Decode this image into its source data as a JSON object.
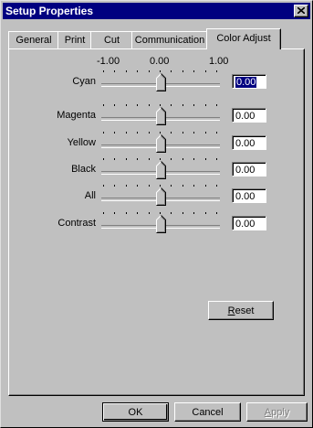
{
  "window": {
    "title": "Setup Properties"
  },
  "tabs": [
    {
      "label": "General"
    },
    {
      "label": "Print"
    },
    {
      "label": "Cut"
    },
    {
      "label": "Communication"
    },
    {
      "label": "Color Adjust"
    }
  ],
  "active_tab": "Color Adjust",
  "scale": {
    "min_label": "-1.00",
    "mid_label": "0.00",
    "max_label": "1.00"
  },
  "sliders": [
    {
      "label": "Cyan",
      "value_text": "0.00",
      "value": 0.0,
      "selected": true
    },
    {
      "label": "Magenta",
      "value_text": "0.00",
      "value": 0.0
    },
    {
      "label": "Yellow",
      "value_text": "0.00",
      "value": 0.0
    },
    {
      "label": "Black",
      "value_text": "0.00",
      "value": 0.0
    },
    {
      "label": "All",
      "value_text": "0.00",
      "value": 0.0
    },
    {
      "label": "Contrast",
      "value_text": "0.00",
      "value": 0.0
    }
  ],
  "buttons": {
    "reset": {
      "label_first": "R",
      "label_rest": "eset"
    },
    "ok": "OK",
    "cancel": "Cancel",
    "apply": {
      "label_first": "A",
      "label_rest": "pply",
      "enabled": false
    }
  }
}
